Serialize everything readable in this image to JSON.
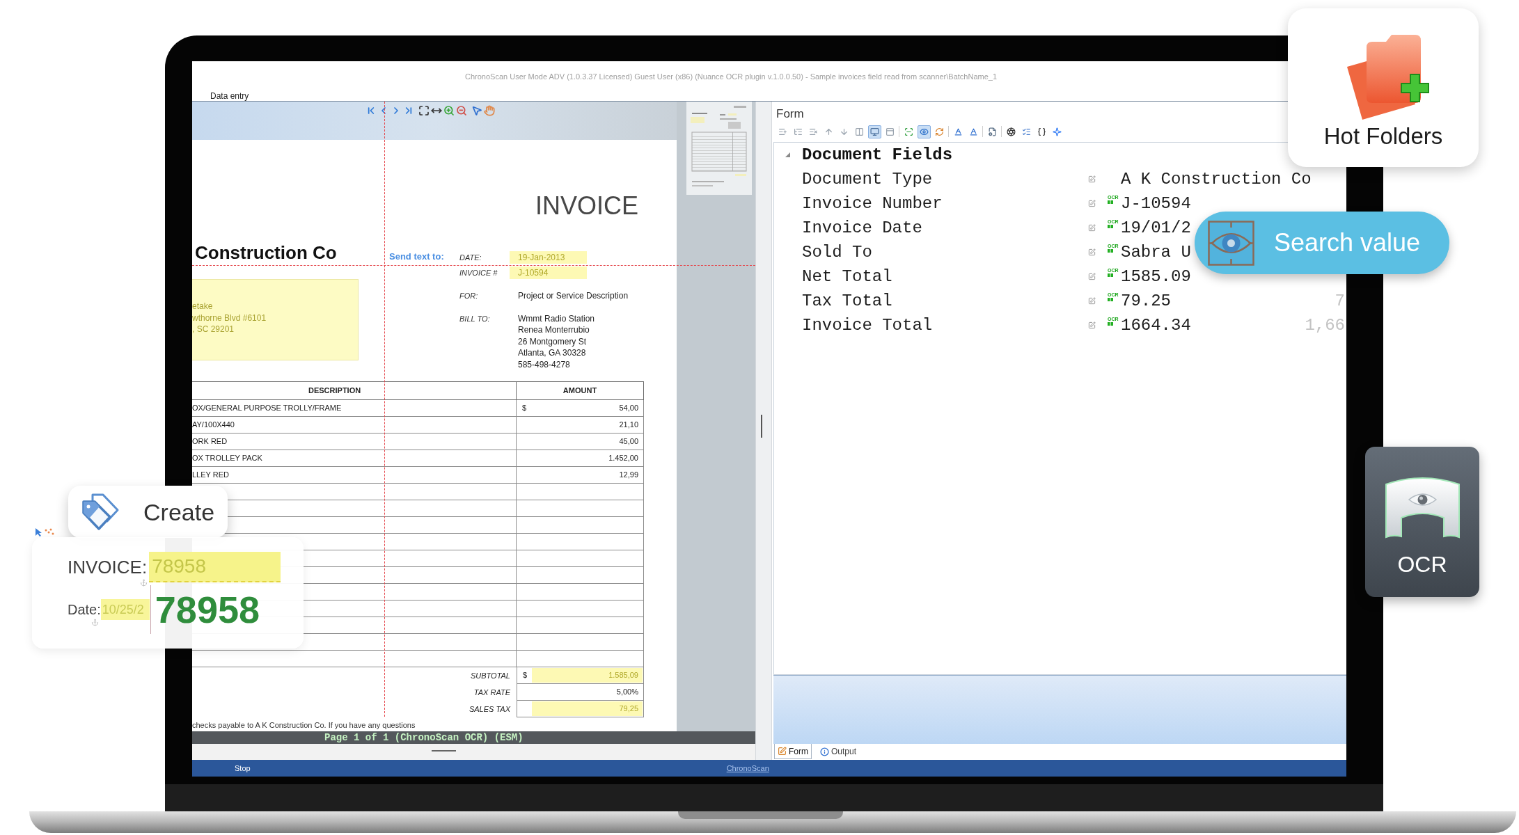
{
  "window": {
    "title": "ChronoScan User Mode ADV (1.0.3.37 Licensed) Guest User (x86) (Nuance OCR plugin v.1.0.0.50) - Sample invoices field read from scanner\\BatchName_1",
    "ribbon_tab": "Data entry"
  },
  "viewer": {
    "document": {
      "title": "INVOICE",
      "company": "Construction Co",
      "address": [
        "etake",
        "wthorne Blvd #6101",
        ", SC 29201"
      ],
      "send_text": "Send text to:",
      "header_fields": [
        {
          "label": "DATE:",
          "highlighted": true,
          "lines": [
            "19-Jan-2013"
          ]
        },
        {
          "label": "INVOICE #",
          "highlighted": true,
          "lines": [
            "J-10594"
          ]
        },
        {
          "label": "FOR:",
          "highlighted": false,
          "lines": [
            "Project or Service Description"
          ]
        },
        {
          "label": "BILL TO:",
          "highlighted": false,
          "lines": [
            "Wmmt Radio Station",
            "Renea Monterrubio",
            "26 Montgomery St",
            "Atlanta, GA 30328",
            "585-498-4278"
          ]
        }
      ],
      "table": {
        "columns": [
          "DESCRIPTION",
          "AMOUNT"
        ],
        "rows": [
          {
            "description": "OX/GENERAL PURPOSE TROLLY/FRAME",
            "currency": "$",
            "amount": "54,00"
          },
          {
            "description": "AY/100X440",
            "amount": "21,10"
          },
          {
            "description": "ORK RED",
            "amount": "45,00"
          },
          {
            "description": "OX TROLLEY PACK",
            "amount": "1.452,00"
          },
          {
            "description": "LLEY RED",
            "amount": "12,99"
          }
        ]
      },
      "totals": [
        {
          "label": "SUBTOTAL",
          "currency": "$",
          "value": "1.585,09",
          "highlighted": true
        },
        {
          "label": "TAX RATE",
          "value": "5,00%",
          "highlighted": false
        },
        {
          "label": "SALES TAX",
          "value": "79,25",
          "highlighted": true
        }
      ],
      "footer": "checks payable to A K Construction Co. If you have any questions"
    },
    "page_status": "Page 1 of 1 (ChronoScan OCR) (ESM)"
  },
  "form": {
    "title": "Form",
    "toolbar": [
      {
        "pressed": false
      },
      {
        "pressed": false
      },
      {
        "pressed": false
      },
      {
        "pressed": false
      },
      {
        "pressed": false
      },
      {
        "pressed": false
      },
      {
        "pressed": true
      },
      {
        "pressed": false
      },
      {
        "pressed": false
      },
      {
        "pressed": true
      },
      {
        "pressed": false
      },
      {
        "pressed": false
      },
      {
        "pressed": false
      },
      {
        "pressed": false
      },
      {
        "pressed": false
      },
      {
        "pressed": false
      },
      {
        "pressed": false
      },
      {
        "pressed": false
      }
    ],
    "tree": {
      "label": "Document Fields",
      "expanded": true,
      "children": [
        {
          "label": "Document Type",
          "value": "A K Construction Co"
        },
        {
          "label": "Invoice Number",
          "badge": "OCR",
          "value": "J-10594"
        },
        {
          "label": "Invoice Date",
          "badge": "OCR",
          "value": "19/01/2"
        },
        {
          "label": "Sold To",
          "badge": "OCR",
          "value": "Sabra U"
        },
        {
          "label": "Net Total",
          "badge": "OCR",
          "value": "1585.09"
        },
        {
          "label": "Tax Total",
          "badge": "OCR",
          "value": "79.25",
          "column_3": "7"
        },
        {
          "label": "Invoice Total",
          "badge": "OCR",
          "value": "1664.34",
          "column_3": "1,66"
        }
      ]
    },
    "tabs": [
      {
        "label": "Form",
        "selected": true
      },
      {
        "label": "Output",
        "selected": false
      }
    ]
  },
  "status_bar": {
    "button": "Stop",
    "link": "ChronoScan"
  },
  "callouts": [
    {
      "kind": "create",
      "label": "Create"
    },
    {
      "kind": "invoice_snippet",
      "invoice_label": "INVOICE:",
      "invoice_value": "78958",
      "date_label": "Date:",
      "date_value": "10/25/2",
      "recognized_value": "78958"
    },
    {
      "kind": "hot_folders",
      "label": "Hot Folders"
    },
    {
      "kind": "search",
      "label": "Search value"
    },
    {
      "kind": "ocr",
      "label": "OCR"
    }
  ]
}
